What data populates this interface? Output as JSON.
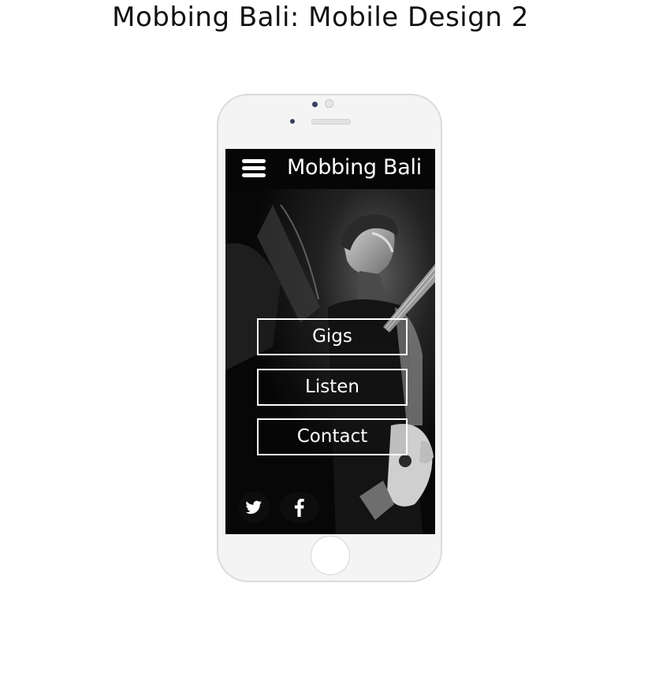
{
  "page": {
    "title": "Mobbing Bali: Mobile Design 2"
  },
  "app": {
    "title": "Mobbing Bali",
    "menu_icon": "hamburger-menu-icon"
  },
  "nav": {
    "items": [
      {
        "label": "Gigs"
      },
      {
        "label": "Listen"
      },
      {
        "label": "Contact"
      }
    ]
  },
  "social": {
    "items": [
      {
        "icon": "twitter-icon"
      },
      {
        "icon": "facebook-icon"
      }
    ]
  },
  "colors": {
    "header_bg": "#060606",
    "screen_bg": "#0b0b0b",
    "text": "#ffffff",
    "phone_body": "#f3f4f3"
  }
}
